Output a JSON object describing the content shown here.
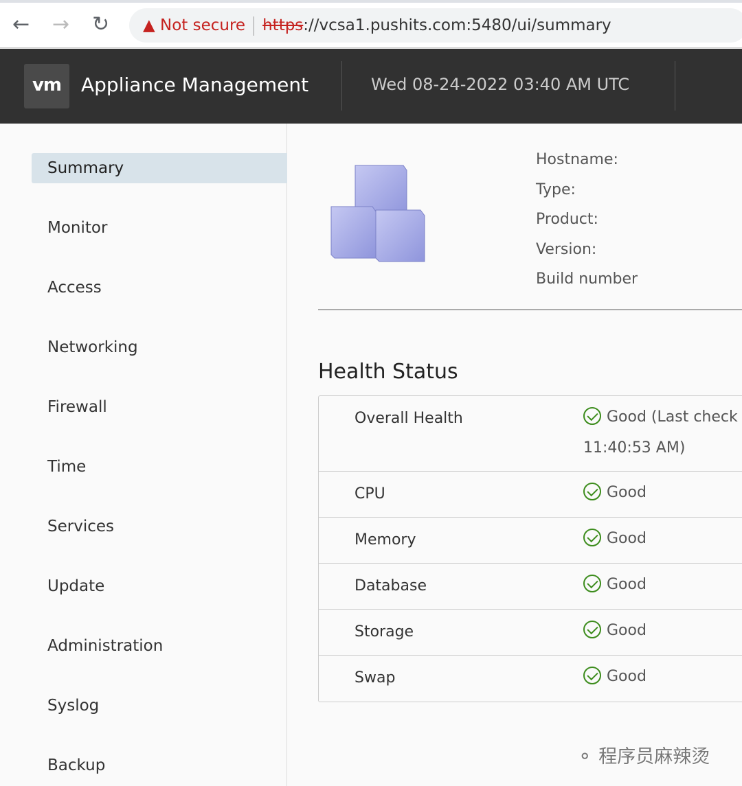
{
  "browser": {
    "not_secure": "Not secure",
    "scheme": "https",
    "url_rest": "://vcsa1.pushits.com:5480/ui/summary"
  },
  "header": {
    "logo": "vm",
    "title": "Appliance Management",
    "datetime": "Wed 08-24-2022 03:40 AM UTC"
  },
  "sidebar": {
    "items": [
      {
        "label": "Summary",
        "active": true
      },
      {
        "label": "Monitor"
      },
      {
        "label": "Access"
      },
      {
        "label": "Networking"
      },
      {
        "label": "Firewall"
      },
      {
        "label": "Time"
      },
      {
        "label": "Services"
      },
      {
        "label": "Update"
      },
      {
        "label": "Administration"
      },
      {
        "label": "Syslog"
      },
      {
        "label": "Backup"
      }
    ]
  },
  "summary": {
    "fields": [
      "Hostname:",
      "Type:",
      "Product:",
      "Version:",
      "Build number"
    ]
  },
  "health": {
    "title": "Health Status",
    "rows": [
      {
        "label": "Overall Health",
        "value": "Good (Last check",
        "value2": "11:40:53 AM)"
      },
      {
        "label": "CPU",
        "value": "Good"
      },
      {
        "label": "Memory",
        "value": "Good"
      },
      {
        "label": "Database",
        "value": "Good"
      },
      {
        "label": "Storage",
        "value": "Good"
      },
      {
        "label": "Swap",
        "value": "Good"
      }
    ]
  },
  "watermark": "程序员麻辣烫",
  "colors": {
    "header": "#313131",
    "active": "#d8e3ea",
    "good": "#3c8c1c",
    "warning": "#c5221f"
  }
}
